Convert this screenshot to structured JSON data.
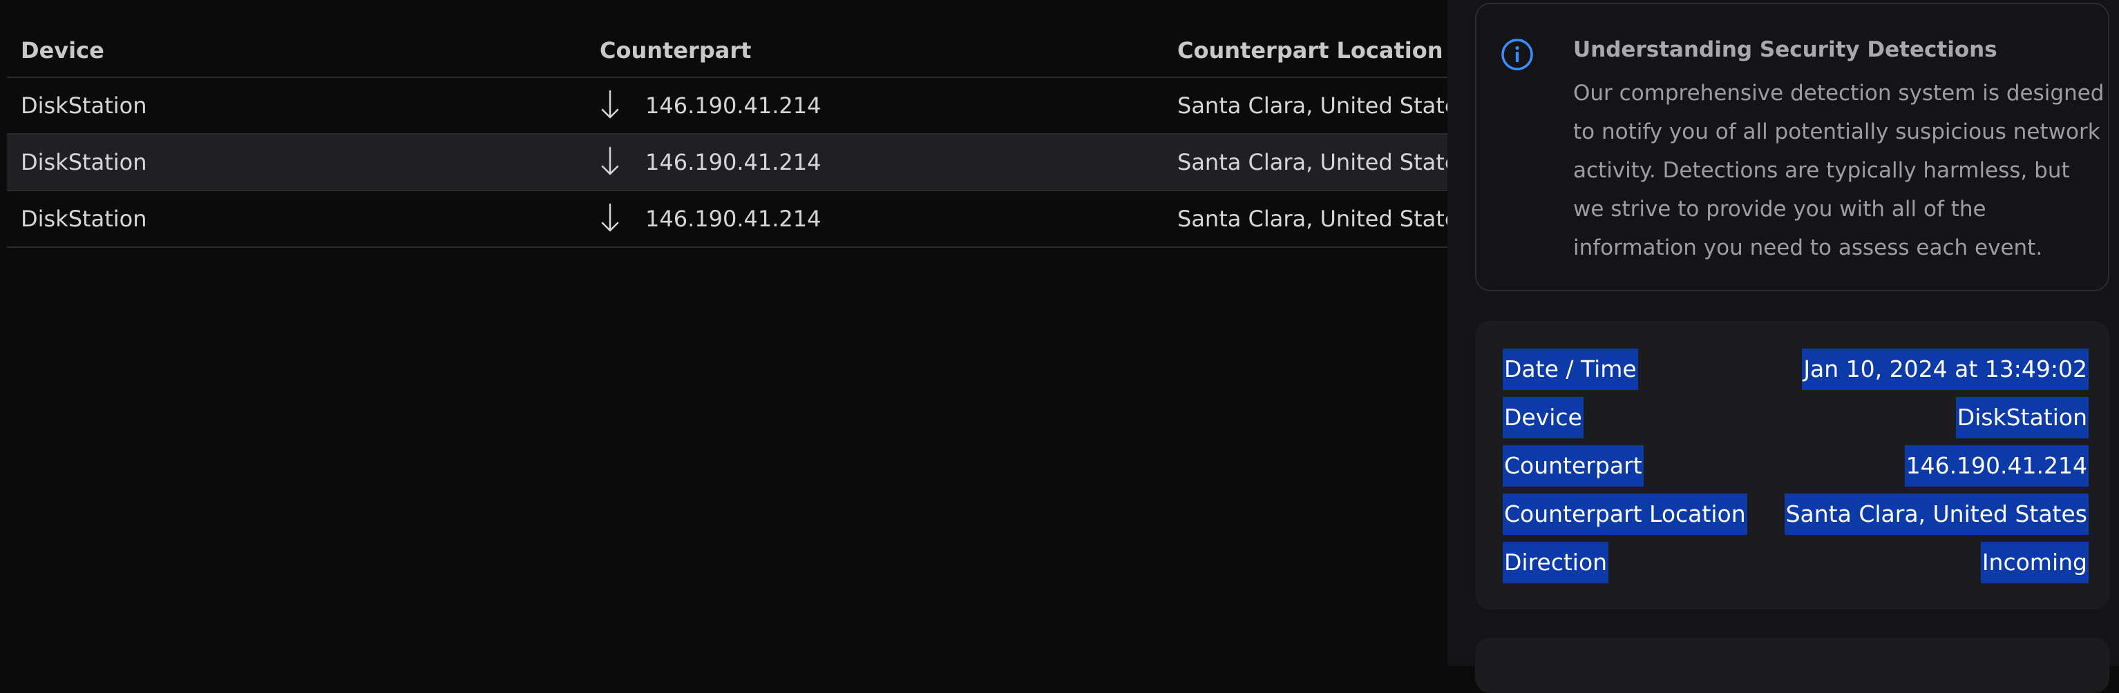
{
  "table": {
    "headers": {
      "device": "Device",
      "counterpart": "Counterpart",
      "location": "Counterpart Location"
    },
    "rows": [
      {
        "device": "DiskStation",
        "direction_icon": "arrow-down-icon",
        "counterpart": "146.190.41.214",
        "location": "Santa Clara, United States"
      },
      {
        "device": "DiskStation",
        "direction_icon": "arrow-down-icon",
        "counterpart": "146.190.41.214",
        "location": "Santa Clara, United States"
      },
      {
        "device": "DiskStation",
        "direction_icon": "arrow-down-icon",
        "counterpart": "146.190.41.214",
        "location": "Santa Clara, United States"
      }
    ]
  },
  "info_card": {
    "icon": "info-icon",
    "title": "Understanding Security Detections",
    "body_lines": [
      "Our comprehensive detection system is designed",
      "to notify you of all potentially suspicious network",
      "activity. Detections are typically harmless, but",
      "we strive to provide you with all of the",
      "information you need to assess each event."
    ]
  },
  "details": {
    "rows": [
      {
        "label": "Date / Time",
        "value": "Jan 10, 2024 at 13:49:02"
      },
      {
        "label": "Device",
        "value": "DiskStation"
      },
      {
        "label": "Counterpart",
        "value": "146.190.41.214"
      },
      {
        "label": "Counterpart Location",
        "value": "Santa Clara, United States"
      },
      {
        "label": "Direction",
        "value": "Incoming"
      }
    ]
  },
  "colors": {
    "background": "#0b0b0c",
    "panel": "#141416",
    "selection": "#0c3aa8",
    "accent_blue": "#3b8cff"
  }
}
